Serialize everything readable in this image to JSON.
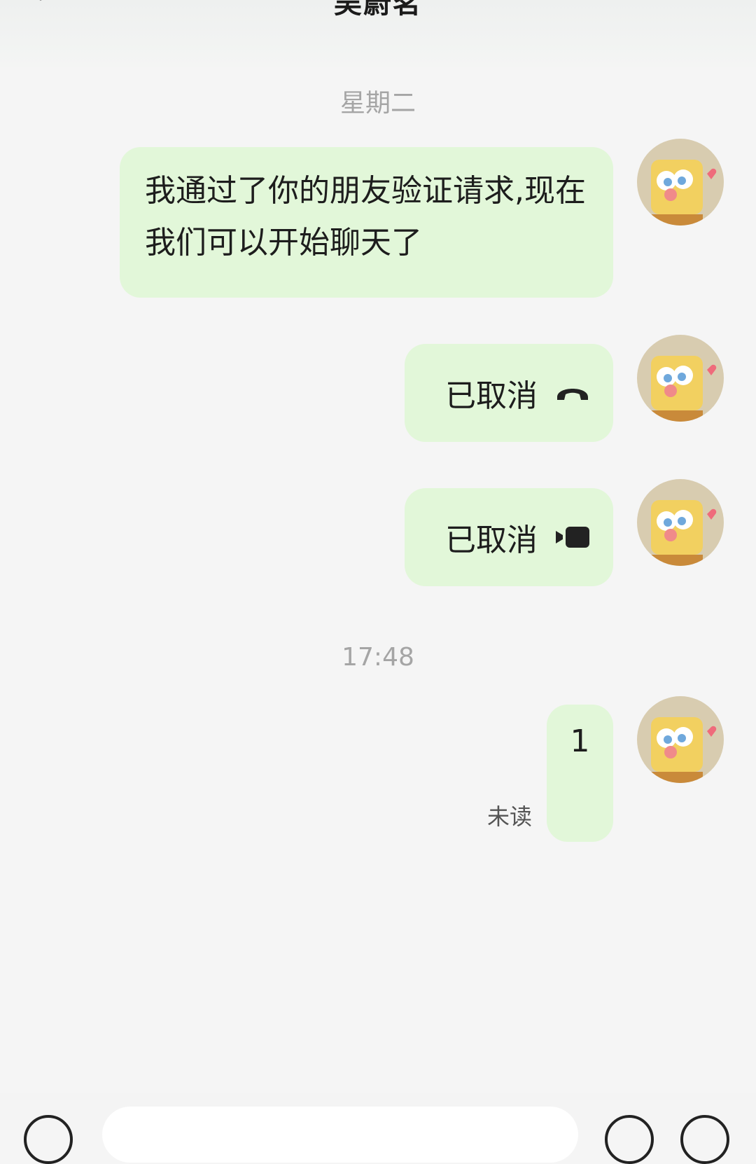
{
  "header": {
    "title": "吴蔚茗",
    "back_icon": "chevron-left-icon"
  },
  "messages": [
    {
      "type": "time",
      "text": "星期二"
    },
    {
      "type": "text",
      "side": "right",
      "text": "我通过了你的朋友验证请求,现在我们可以开始聊天了"
    },
    {
      "type": "voice-call",
      "side": "right",
      "text": "已取消",
      "icon": "phone-hangup-icon"
    },
    {
      "type": "video-call",
      "side": "right",
      "text": "已取消",
      "icon": "video-camera-icon"
    },
    {
      "type": "time",
      "text": "17:48"
    },
    {
      "type": "text",
      "side": "right",
      "text": "1",
      "status": "未读"
    }
  ],
  "colors": {
    "bubble_self": "#e2f7d9",
    "background": "#f5f5f5",
    "timestamp": "#a5a5a5"
  },
  "input_bar": {
    "voice_icon": "voice-toggle-icon",
    "emoji_icon": "emoji-icon",
    "more_icon": "plus-icon"
  }
}
